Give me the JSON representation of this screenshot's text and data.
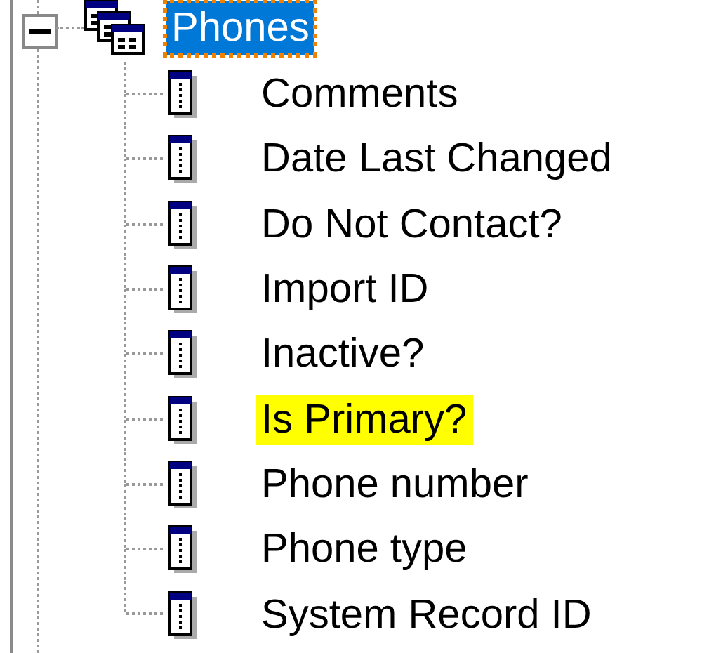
{
  "tree": {
    "label": "Phones",
    "expanded": true,
    "selected": true,
    "children": [
      {
        "label": "Comments",
        "highlighted": false
      },
      {
        "label": "Date Last Changed",
        "highlighted": false
      },
      {
        "label": "Do Not Contact?",
        "highlighted": false
      },
      {
        "label": "Import ID",
        "highlighted": false
      },
      {
        "label": "Inactive?",
        "highlighted": false
      },
      {
        "label": "Is Primary?",
        "highlighted": true
      },
      {
        "label": "Phone number",
        "highlighted": false
      },
      {
        "label": "Phone type",
        "highlighted": false
      },
      {
        "label": "System Record ID",
        "highlighted": false
      }
    ]
  }
}
